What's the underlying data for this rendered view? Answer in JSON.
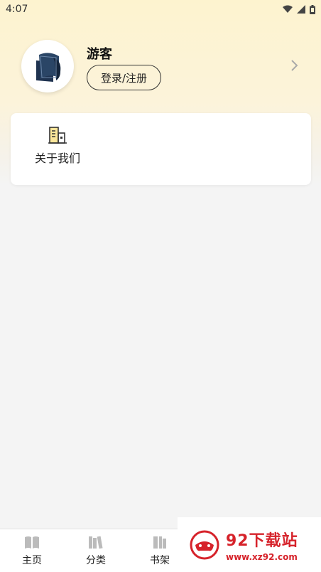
{
  "status_bar": {
    "time": "4:07",
    "icons": [
      "wifi-icon",
      "signal-icon",
      "battery-icon"
    ]
  },
  "profile": {
    "username": "游客",
    "login_label": "登录/注册",
    "avatar_icon": "book-icon",
    "chevron_icon": "chevron-right-icon"
  },
  "menu": {
    "items": [
      {
        "label": "关于我们",
        "icon": "building-icon"
      }
    ]
  },
  "bottom_nav": {
    "items": [
      {
        "label": "主页",
        "icon": "open-book-icon"
      },
      {
        "label": "分类",
        "icon": "books-icon"
      },
      {
        "label": "书架",
        "icon": "bookshelf-icon"
      }
    ]
  },
  "watermark": {
    "title": "92下载站",
    "url": "www.xz92.com"
  },
  "colors": {
    "header_gradient_top": "#fdf3cf",
    "background": "#f4f4f4",
    "watermark_red": "#d6232b"
  }
}
